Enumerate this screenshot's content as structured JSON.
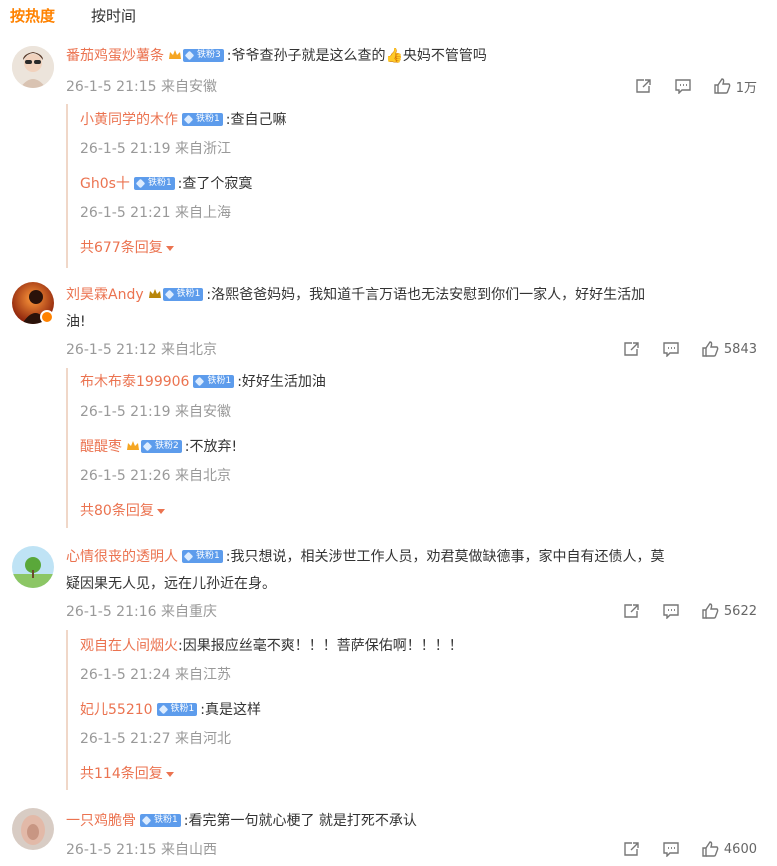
{
  "tabs": [
    "按热度",
    "按时间"
  ],
  "colors": {
    "accent": "#ff8200",
    "username": "#eb7350",
    "meta": "#999999",
    "badge": "#5d9cec"
  },
  "comments": [
    {
      "username": "番茄鸡蛋炒薯条",
      "badge": "铁粉3",
      "text": ":爷爷查孙子就是这么查的👍央妈不管管吗",
      "text2": "",
      "meta": "26-1-5 21:15 来自安徽",
      "likes": "1万",
      "replies": [
        {
          "username": "小黄同学的木作",
          "badge": "铁粉1",
          "text": ":查自己嘛",
          "meta": "26-1-5 21:19 来自浙江"
        },
        {
          "username": "Gh0s十",
          "badge": "铁粉1",
          "text": ":查了个寂寞",
          "meta": "26-1-5 21:21 来自上海"
        }
      ],
      "more": "共677条回复"
    },
    {
      "username": "刘昊霖Andy",
      "badge": "铁粉1",
      "text": ":洛熙爸爸妈妈，我知道千言万语也无法安慰到你们一家人，好好生活加",
      "text2": "油!",
      "meta": "26-1-5 21:12 来自北京",
      "likes": "5843",
      "replies": [
        {
          "username": "布木布泰199906",
          "badge": "铁粉1",
          "text": ":好好生活加油",
          "meta": "26-1-5 21:19 来自安徽"
        },
        {
          "username": "醍醍枣",
          "badge": "铁粉2",
          "text": ":不放弃!",
          "meta": "26-1-5 21:26 来自北京"
        }
      ],
      "more": "共80条回复"
    },
    {
      "username": "心情很丧的透明人",
      "badge": "铁粉1",
      "text": ":我只想说，相关涉世工作人员，劝君莫做缺德事，家中自有还债人，莫",
      "text2": "疑因果无人见，远在儿孙近在身。",
      "meta": "26-1-5 21:16 来自重庆",
      "likes": "5622",
      "replies": [
        {
          "username": "观自在人间烟火",
          "badge": "",
          "text": ":因果报应丝毫不爽！！！菩萨保佑啊！！！！",
          "meta": "26-1-5 21:24 来自江苏"
        },
        {
          "username": "妃儿55210",
          "badge": "铁粉1",
          "text": ":真是这样",
          "meta": "26-1-5 21:27 来自河北"
        }
      ],
      "more": "共114条回复"
    },
    {
      "username": "一只鸡脆骨",
      "badge": "铁粉1",
      "text": ":看完第一句就心梗了 就是打死不承认",
      "text2": "",
      "meta": "26-1-5 21:15 来自山西",
      "likes": "4600",
      "replies": [],
      "more": ""
    }
  ]
}
